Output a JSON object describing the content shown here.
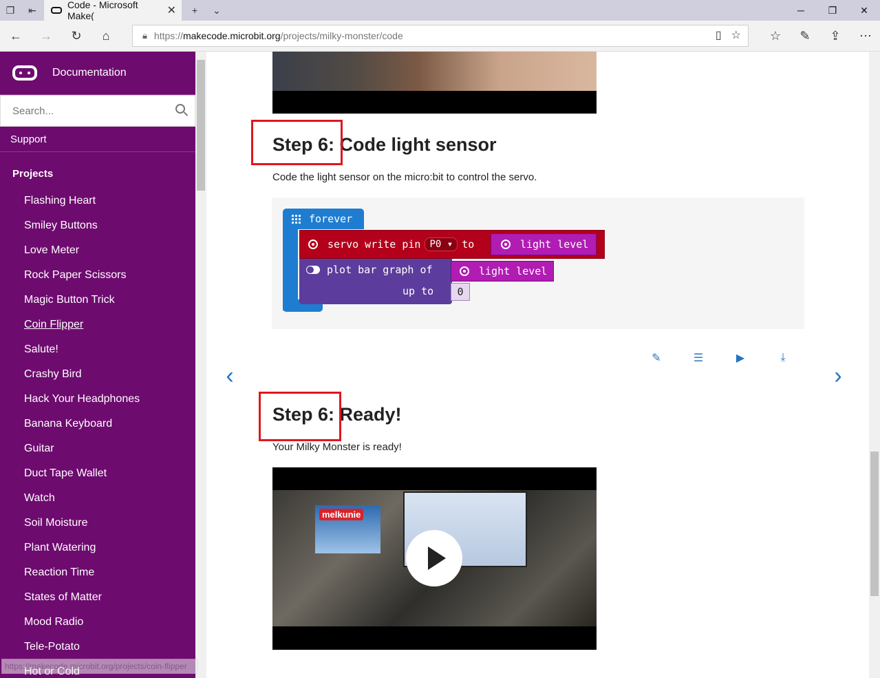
{
  "browser": {
    "tab_title": "Code - Microsoft Make(",
    "url_scheme": "https://",
    "url_host": "makecode.microbit.org",
    "url_path": "/projects/milky-monster/code",
    "status_url": "https://makecode.microbit.org/projects/coin-flipper"
  },
  "sidebar": {
    "title": "Documentation",
    "search_placeholder": "Search...",
    "support": "Support",
    "projects_heading": "Projects",
    "items": [
      "Flashing Heart",
      "Smiley Buttons",
      "Love Meter",
      "Rock Paper Scissors",
      "Magic Button Trick",
      "Coin Flipper",
      "Salute!",
      "Crashy Bird",
      "Hack Your Headphones",
      "Banana Keyboard",
      "Guitar",
      "Duct Tape Wallet",
      "Watch",
      "Soil Moisture",
      "Plant Watering",
      "Reaction Time",
      "States of Matter",
      "Mood Radio",
      "Tele-Potato",
      "Hot or Cold"
    ]
  },
  "content": {
    "step1_title": "Step 6: Code light sensor",
    "step1_desc": "Code the light sensor on the micro:bit to control the servo.",
    "step2_title": "Step 6: Ready!",
    "step2_desc": "Your Milky Monster is ready!",
    "carton_text": "melkunie"
  },
  "code_blocks": {
    "forever": "forever",
    "servo_write": "servo write pin",
    "pin": "P0 ▾",
    "to": "to",
    "light_level": "light level",
    "plot_bar": "plot bar graph of",
    "up_to": "up to",
    "zero": "0"
  },
  "colors": {
    "sidebar_bg": "#6e0b6f",
    "accent_blue": "#2572c4",
    "highlight_red": "#e0161e",
    "forever_block": "#1f7dd1",
    "servo_block": "#b3001b",
    "led_block": "#5c3c9c",
    "input_block": "#b11cb3"
  }
}
